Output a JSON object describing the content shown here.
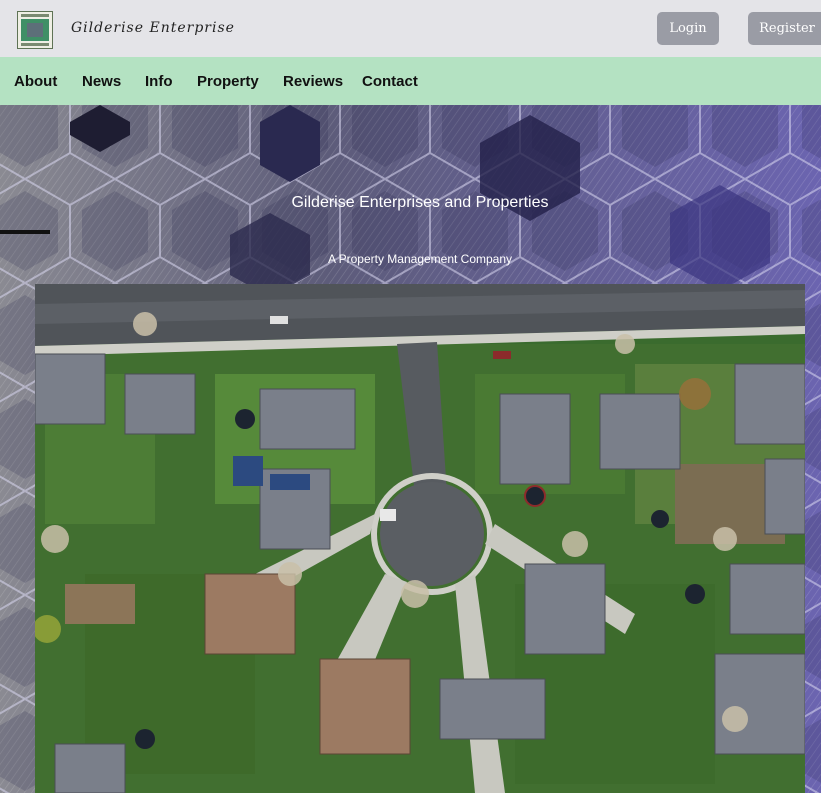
{
  "header": {
    "brand": "Gilderise Enterprise",
    "login_label": "Login",
    "register_label": "Register"
  },
  "nav": {
    "items": [
      "About",
      "News",
      "Info",
      "Property",
      "Reviews",
      "Contact"
    ]
  },
  "hero": {
    "title": "Gilderise Enterprises and Properties",
    "subtitle": "A Property Management Company"
  },
  "colors": {
    "nav_bg": "#b4e2c2",
    "topbar_bg": "#e4e4e8",
    "button_bg": "#9a9ca5",
    "hero_pattern": "#4a4878"
  },
  "icons": {
    "logo": "company-logo-icon",
    "hero_image": "aerial-neighborhood-photo"
  }
}
